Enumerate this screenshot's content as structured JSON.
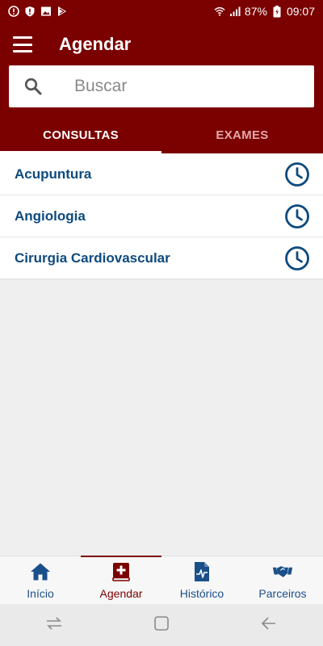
{
  "status_bar": {
    "battery": "87%",
    "time": "09:07"
  },
  "app_bar": {
    "title": "Agendar"
  },
  "search": {
    "placeholder": "Buscar"
  },
  "tabs": [
    {
      "label": "CONSULTAS",
      "active": true
    },
    {
      "label": "EXAMES",
      "active": false
    }
  ],
  "specialties": [
    {
      "label": "Acupuntura"
    },
    {
      "label": "Angiologia"
    },
    {
      "label": "Cirurgia Cardiovascular"
    }
  ],
  "bottom_nav": [
    {
      "label": "Início",
      "icon": "home-icon"
    },
    {
      "label": "Agendar",
      "icon": "medical-book-icon",
      "active": true
    },
    {
      "label": "Histórico",
      "icon": "document-pulse-icon"
    },
    {
      "label": "Parceiros",
      "icon": "handshake-icon"
    }
  ],
  "colors": {
    "primary": "#7b0000",
    "link": "#0d4a7e",
    "nav": "#1b4f8a"
  }
}
